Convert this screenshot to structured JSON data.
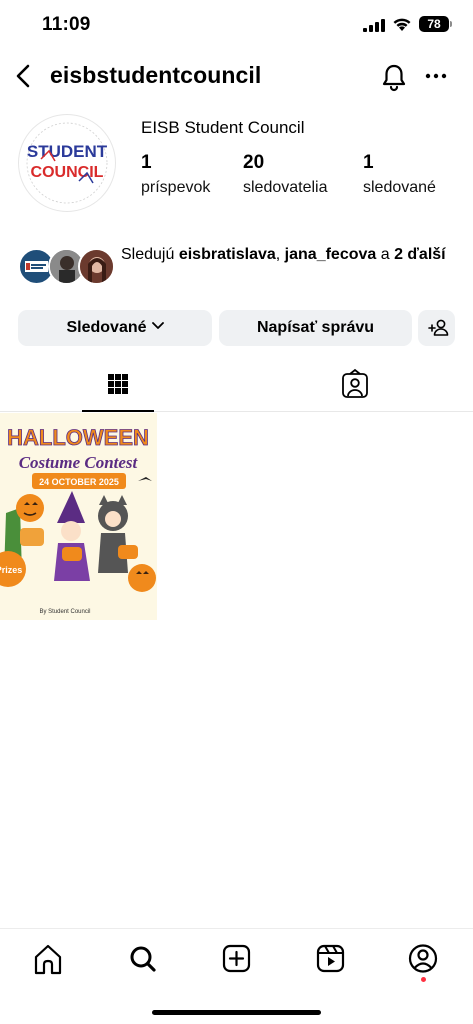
{
  "status_bar": {
    "time": "11:09",
    "battery": "78"
  },
  "header": {
    "username": "eisbstudentcouncil"
  },
  "profile": {
    "full_name": "EISB Student Council",
    "logo_text_line1": "STUDENT",
    "logo_text_line2": "COUNCIL",
    "stats": [
      {
        "value": "1",
        "label": "príspevok"
      },
      {
        "value": "20",
        "label": "sledovatelia"
      },
      {
        "value": "1",
        "label": "sledované"
      }
    ]
  },
  "followed_by": {
    "prefix": "Sledujú ",
    "user1": "eisbratislava",
    "separator": ", ",
    "user2": "jana_fecova",
    "conjunction": " a ",
    "others": "2 ďalší"
  },
  "actions": {
    "following_label": "Sledované",
    "message_label": "Napísať správu"
  },
  "posts": [
    {
      "title_line1": "HALLOWEEN",
      "title_line2": "Costume Contest",
      "date": "24 OCTOBER 2025",
      "badge": "Prizes",
      "credit": "By Student Council"
    }
  ],
  "colors": {
    "button_bg": "#eff1f3",
    "notification_dot": "#ff3040",
    "halloween_orange": "#f08a1c",
    "halloween_purple": "#5b2c83"
  }
}
